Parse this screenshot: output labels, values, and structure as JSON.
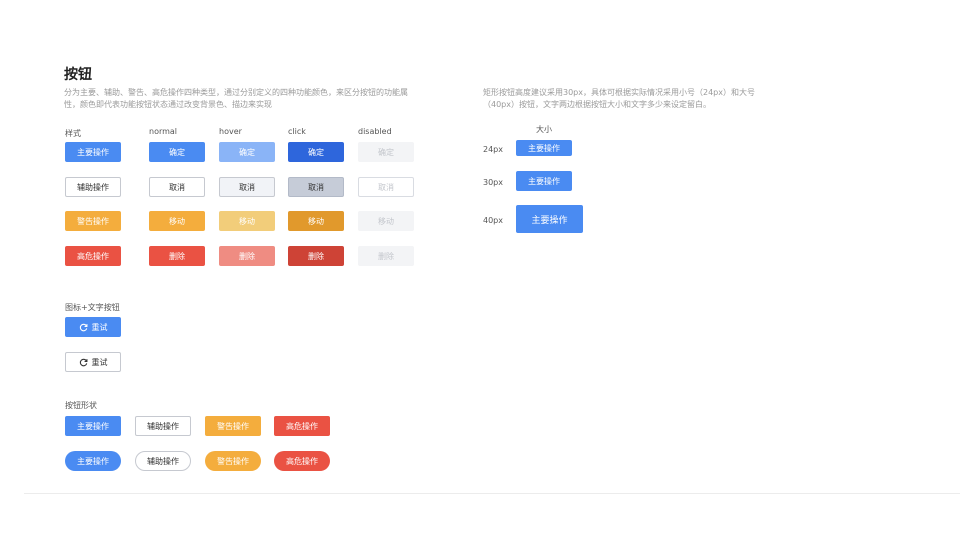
{
  "title": "按钮",
  "description_left": "分为主要、辅助、警告、高危操作四种类型，通过分别定义的四种功能颜色，来区分按钮的功能属性，颜色即代表功能按钮状态通过改变背景色、描边来实现",
  "description_right": "矩形按钮高度建议采用30px，具体可根据实际情况采用小号（24px）和大号（40px）按钮，文字两边根据按钮大小和文字多少来设定留白。",
  "states": {
    "col_style": "样式",
    "col_normal": "normal",
    "col_hover": "hover",
    "col_click": "click",
    "col_disabled": "disabled",
    "rows": {
      "primary": {
        "style": "主要操作",
        "label": "确定"
      },
      "aux": {
        "style": "辅助操作",
        "label": "取消"
      },
      "warn": {
        "style": "警告操作",
        "label": "移动"
      },
      "danger": {
        "style": "高危操作",
        "label": "删除"
      }
    }
  },
  "sizes": {
    "heading": "大小",
    "small_label": "24px",
    "medium_label": "30px",
    "large_label": "40px",
    "button_label": "主要操作"
  },
  "icon_text": {
    "heading": "图标+文字按钮",
    "label": "重试",
    "icon": "refresh-icon"
  },
  "shapes": {
    "heading": "按钮形状",
    "primary": "主要操作",
    "aux": "辅助操作",
    "warn": "警告操作",
    "danger": "高危操作"
  },
  "colors": {
    "primary": "#4a8bf2",
    "primary_hover": "#8ab4f7",
    "primary_click": "#2e66dc",
    "warning": "#f4ad3d",
    "danger": "#ea5243",
    "disabled_bg": "#f3f4f6"
  }
}
